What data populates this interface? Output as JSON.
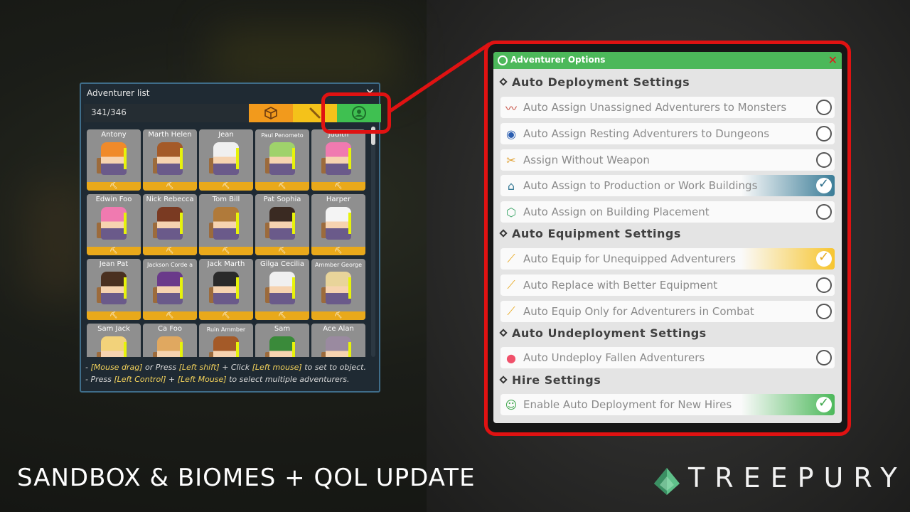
{
  "adventurer_list": {
    "title": "Adventurer list",
    "close": "✕",
    "count": "341/346",
    "tabs": [
      "box-icon",
      "weapon-icon",
      "adventurer-icon"
    ],
    "cards": [
      {
        "name": "Antony",
        "hair": "#f08a2a",
        "foot": "⛏"
      },
      {
        "name": "Marth Helen",
        "hair": "#a45a28",
        "foot": "⛏"
      },
      {
        "name": "Jean",
        "hair": "#f0f0f0",
        "foot": "⛏"
      },
      {
        "name": "Paul Penometo",
        "hair": "#9fd26b",
        "foot": "⛏",
        "small": true
      },
      {
        "name": "Judith",
        "hair": "#f07ab0",
        "foot": "⛏"
      },
      {
        "name": "Edwin Foo",
        "hair": "#f07ab0",
        "foot": "⛏"
      },
      {
        "name": "Nick Rebecca",
        "hair": "#7a3a22",
        "foot": "⛏"
      },
      {
        "name": "Tom Bill",
        "hair": "#b07a3a",
        "foot": "⛏"
      },
      {
        "name": "Pat Sophia",
        "hair": "#3a2a22",
        "foot": "⛏"
      },
      {
        "name": "Harper",
        "hair": "#f4f4f4",
        "foot": "⛏"
      },
      {
        "name": "Jean Pat",
        "hair": "#4a3020",
        "foot": "⛏"
      },
      {
        "name": "Jackson Corde a",
        "hair": "#6a3a8a",
        "foot": "⛏",
        "small": true
      },
      {
        "name": "Jack Marth",
        "hair": "#2a2a2a",
        "foot": "⛏"
      },
      {
        "name": "Gilga Cecilia",
        "hair": "#f0f0f0",
        "foot": "⛏"
      },
      {
        "name": "Ammber George",
        "hair": "#e8d49a",
        "foot": "⛏",
        "small": true
      },
      {
        "name": "Sam Jack",
        "hair": "#f2d27a",
        "foot": "⛏"
      },
      {
        "name": "Ca Foo",
        "hair": "#e0a860",
        "foot": "⛏"
      },
      {
        "name": "Ruin Ammber",
        "hair": "#a45a28",
        "foot": "⛏",
        "small": true
      },
      {
        "name": "Sam",
        "hair": "#3a8a3a",
        "foot": "⛏"
      },
      {
        "name": "Ace Alan",
        "hair": "#9a8aa0",
        "foot": "⛏"
      }
    ],
    "hint1_a": "- ",
    "hint1_k1": "[Mouse drag]",
    "hint1_b": " or Press ",
    "hint1_k2": "[Left shift]",
    "hint1_c": " + Click ",
    "hint1_k3": "[Left mouse]",
    "hint1_d": " to set to object.",
    "hint2_a": "- Press ",
    "hint2_k1": "[Left Control]",
    "hint2_b": " + ",
    "hint2_k2": "[Left Mouse]",
    "hint2_c": " to select multiple adventurers."
  },
  "options": {
    "title": "Adventurer Options",
    "close": "✕",
    "sections": {
      "deploy": "Auto Deployment Settings",
      "equip": "Auto Equipment Settings",
      "undeploy": "Auto Undeployment Settings",
      "hire": "Hire Settings"
    },
    "rows": [
      {
        "label": "Auto Assign Unassigned Adventurers to Monsters",
        "icon": "monster-icon",
        "checked": false
      },
      {
        "label": "Auto Assign Resting Adventurers to Dungeons",
        "icon": "portal-icon",
        "checked": false
      },
      {
        "label": "Assign Without Weapon",
        "icon": "no-weapon-icon",
        "checked": false
      },
      {
        "label": "Auto Assign to Production or Work Buildings",
        "icon": "building-icon",
        "checked": true
      },
      {
        "label": "Auto Assign on Building Placement",
        "icon": "cube-icon",
        "checked": false
      },
      {
        "label": "Auto Equip for Unequipped Adventurers",
        "icon": "sword-icon",
        "checked": true
      },
      {
        "label": "Auto Replace with Better Equipment",
        "icon": "sword-icon",
        "checked": false
      },
      {
        "label": "Auto Equip Only for Adventurers in Combat",
        "icon": "sword-icon",
        "checked": false
      },
      {
        "label": "Auto Undeploy Fallen Adventurers",
        "icon": "ghost-icon",
        "checked": false
      },
      {
        "label": "Enable Auto Deployment for New Hires",
        "icon": "hire-icon",
        "checked": true
      }
    ]
  },
  "banner": "SANDBOX & BIOMES + QOL UPDATE",
  "logo_text": "TREEPURY"
}
